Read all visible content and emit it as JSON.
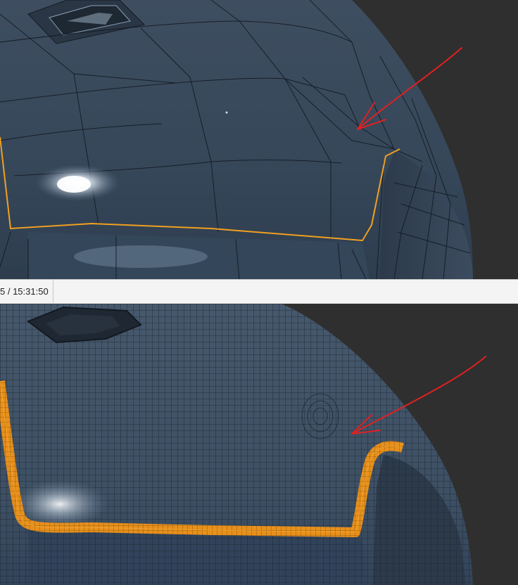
{
  "status_bar": {
    "timestamp": "5 / 15:31:50"
  },
  "viewports": {
    "background": "#2f2f2f",
    "mesh_color": "#3a4a5c",
    "selection_color": "#f0a020",
    "annotation_color": "#e02020",
    "top": {
      "icon": "low-poly-mesh",
      "annotation_icon": "red-arrow-icon"
    },
    "bottom": {
      "icon": "subdivided-mesh",
      "annotation_icon": "red-arrow-icon"
    }
  }
}
